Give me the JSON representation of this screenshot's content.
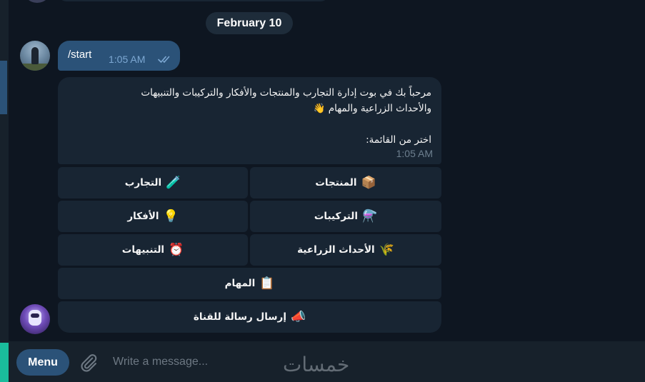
{
  "chat": {
    "date_separator": "February 10",
    "outgoing": {
      "text": "/start",
      "time": "1:05 AM",
      "status": "read"
    },
    "incoming": {
      "line1": "مرحباً بك في بوت إدارة التجارب والمنتجات والأفكار والتركيبات والتنبيهات",
      "line2": "والأحداث الزراعية والمهام 👋",
      "line3": "اختر من القائمة:",
      "time": "1:05 AM"
    },
    "keyboard": [
      {
        "label": "المنتجات",
        "emoji": "📦"
      },
      {
        "label": "التجارب",
        "emoji": "🧪"
      },
      {
        "label": "التركيبات",
        "emoji": "⚗️"
      },
      {
        "label": "الأفكار",
        "emoji": "💡"
      },
      {
        "label": "الأحداث الزراعية",
        "emoji": "🌾"
      },
      {
        "label": "التنبيهات",
        "emoji": "⏰"
      },
      {
        "label": "المهام",
        "emoji": "📋"
      },
      {
        "label": "إرسال رسالة للقناة",
        "emoji": "📣"
      }
    ]
  },
  "composer": {
    "menu_label": "Menu",
    "placeholder": "Write a message...",
    "attach_icon": "paperclip-icon"
  },
  "watermark": "خمسات",
  "colors": {
    "background": "#0e1621",
    "bubble_in": "#182533",
    "bubble_out": "#2b5278",
    "accent": "#1abc9c"
  }
}
